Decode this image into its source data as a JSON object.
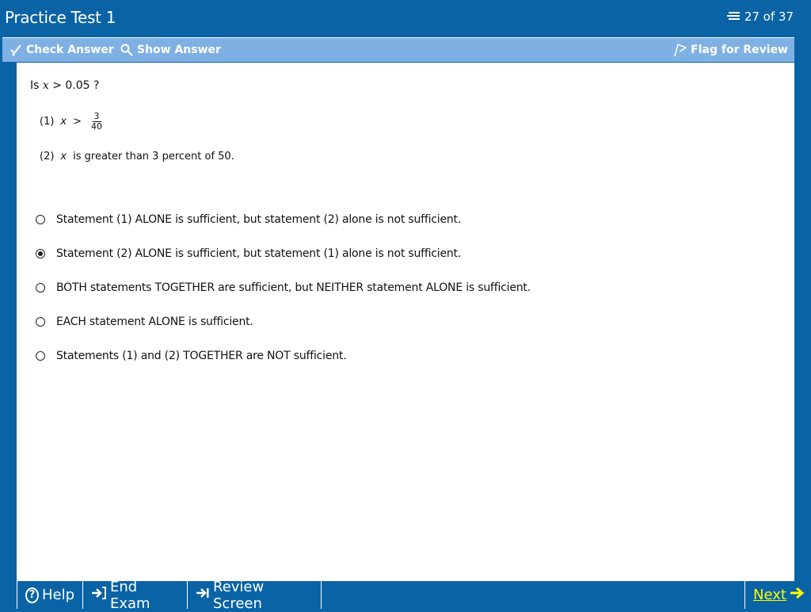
{
  "header": {
    "title": "Practice Test 1",
    "progress": "27 of 37",
    "progress_icon": "list-icon"
  },
  "toolbar": {
    "check_answer": "Check Answer",
    "show_answer": "Show Answer",
    "flag_for_review": "Flag for Review"
  },
  "question": {
    "prompt_prefix": "Is ",
    "prompt_var": "x",
    "prompt_suffix": " > 0.05 ?",
    "statement1": {
      "label": "(1)",
      "var": "x",
      "op": ">",
      "numerator": "3",
      "denominator": "40"
    },
    "statement2": {
      "label": "(2)",
      "var": "x",
      "text": "is greater than 3 percent of 50."
    }
  },
  "choices": [
    {
      "text": "Statement (1) ALONE is sufficient, but statement (2) alone is not sufficient.",
      "selected": false
    },
    {
      "text": "Statement (2) ALONE is sufficient, but statement (1) alone is not sufficient.",
      "selected": true
    },
    {
      "text": "BOTH statements TOGETHER are sufficient, but NEITHER statement ALONE is sufficient.",
      "selected": false
    },
    {
      "text": "EACH statement ALONE is sufficient.",
      "selected": false
    },
    {
      "text": "Statements (1) and (2) TOGETHER are NOT sufficient.",
      "selected": false
    }
  ],
  "footer": {
    "help": "Help",
    "end_exam": "End Exam",
    "review_screen": "Review Screen",
    "next": "Next"
  },
  "colors": {
    "frame_blue": "#0a63a5",
    "toolbar_blue": "#7fb0e3",
    "next_yellow": "#ffff00"
  }
}
